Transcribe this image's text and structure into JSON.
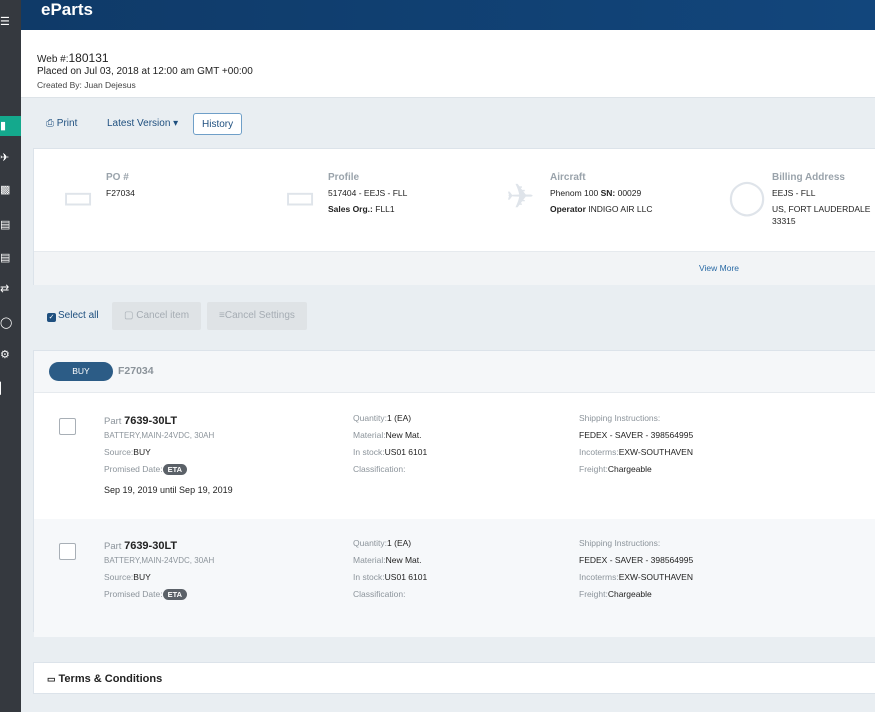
{
  "app": {
    "brand": "eParts"
  },
  "rail": {
    "icons": [
      "menu-icon",
      "truck-icon",
      "plane-icon",
      "cart-icon",
      "document-icon",
      "clipboard-icon",
      "transfer-icon",
      "dollar-icon",
      "settings-icon",
      "chart-icon"
    ],
    "active_index": 1
  },
  "order": {
    "web_label": "Web #:",
    "web_number": "180131",
    "placed": "Placed on Jul 03, 2018 at 12:00 am GMT +00:00",
    "created_by": "Created By: Juan Dejesus"
  },
  "toolbar": {
    "print_label": "Print",
    "version_label": "Latest Version",
    "history_label": "History"
  },
  "info": {
    "po": {
      "label": "PO #",
      "value": "F27034"
    },
    "profile": {
      "label": "Profile",
      "value": "517404 - EEJS - FLL",
      "sales_org_label": "Sales Org.:",
      "sales_org": "FLL1"
    },
    "aircraft": {
      "label": "Aircraft",
      "model": "Phenom 100",
      "sn_label": "SN:",
      "sn": "00029",
      "operator_label": "Operator",
      "operator": "INDIGO AIR LLC"
    },
    "billing": {
      "label": "Billing Address",
      "line1": "EEJS - FLL",
      "line2": "US, FORT LAUDERDALE",
      "line3": "33315"
    },
    "view_more": "View More"
  },
  "selection": {
    "select_all": "Select all",
    "cancel_item": "Cancel item",
    "cancel_settings": "Cancel Settings"
  },
  "items": {
    "type_badge": "BUY",
    "po_ref": "F27034",
    "rows": [
      {
        "part_label": "Part",
        "part_number": "7639-30LT",
        "description": "BATTERY,MAIN-24VDC, 30AH",
        "source_label": "Source:",
        "source": "BUY",
        "promised_label": "Promised Date:",
        "eta": "ETA",
        "dates": "Sep 19, 2019 until Sep 19, 2019",
        "quantity_label": "Quantity:",
        "quantity": "1 (EA)",
        "material_label": "Material:",
        "material": "New Mat.",
        "stock_label": "In stock:",
        "stock": "US01 6101",
        "classification_label": "Classification:",
        "shipping_label": "Shipping Instructions:",
        "shipping": "FEDEX - SAVER - 398564995",
        "incoterms_label": "Incoterms:",
        "incoterms": "EXW-SOUTHAVEN",
        "freight_label": "Freight:",
        "freight": "Chargeable"
      },
      {
        "part_label": "Part",
        "part_number": "7639-30LT",
        "description": "BATTERY,MAIN-24VDC, 30AH",
        "source_label": "Source:",
        "source": "BUY",
        "promised_label": "Promised Date:",
        "eta": "ETA",
        "dates": "",
        "quantity_label": "Quantity:",
        "quantity": "1 (EA)",
        "material_label": "Material:",
        "material": "New Mat.",
        "stock_label": "In stock:",
        "stock": "US01 6101",
        "classification_label": "Classification:",
        "shipping_label": "Shipping Instructions:",
        "shipping": "FEDEX - SAVER - 398564995",
        "incoterms_label": "Incoterms:",
        "incoterms": "EXW-SOUTHAVEN",
        "freight_label": "Freight:",
        "freight": "Chargeable"
      }
    ]
  },
  "terms": {
    "title": "Terms & Conditions"
  }
}
